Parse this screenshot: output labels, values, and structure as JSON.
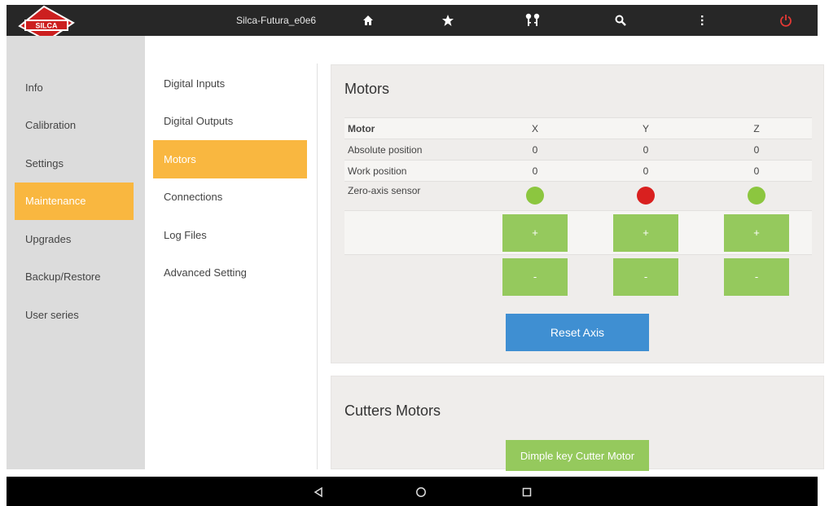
{
  "header": {
    "logo_text": "SILCA",
    "device_name": "Silca-Futura_e0e6",
    "icons": [
      "home-icon",
      "star-icon",
      "keys-icon",
      "search-icon",
      "more-vertical-icon",
      "power-icon"
    ]
  },
  "sidebar": {
    "items": [
      {
        "label": "Info"
      },
      {
        "label": "Calibration"
      },
      {
        "label": "Settings"
      },
      {
        "label": "Maintenance",
        "active": true
      },
      {
        "label": "Upgrades"
      },
      {
        "label": "Backup/Restore"
      },
      {
        "label": "User series"
      }
    ]
  },
  "subnav": {
    "items": [
      {
        "label": "Digital Inputs"
      },
      {
        "label": "Digital Outputs"
      },
      {
        "label": "Motors",
        "active": true
      },
      {
        "label": "Connections"
      },
      {
        "label": "Log Files"
      },
      {
        "label": "Advanced Setting"
      }
    ]
  },
  "motors": {
    "title": "Motors",
    "columns": [
      "Motor",
      "X",
      "Y",
      "Z"
    ],
    "rows": [
      {
        "label": "Absolute position",
        "values": [
          "0",
          "0",
          "0"
        ]
      },
      {
        "label": "Work position",
        "values": [
          "0",
          "0",
          "0"
        ]
      }
    ],
    "sensor": {
      "label": "Zero-axis sensor",
      "states": [
        "green",
        "red",
        "green"
      ]
    },
    "plus_label": "+",
    "minus_label": "-",
    "reset_label": "Reset Axis"
  },
  "cutters": {
    "title": "Cutters Motors",
    "button_label": "Dimple key Cutter Motor"
  },
  "colors": {
    "accent": "#f9b740",
    "green": "#95c95d",
    "blue": "#3f8fd2",
    "sensor_green": "#8cc63f",
    "sensor_red": "#d9201f",
    "power": "#e53935"
  },
  "android_nav": [
    "back-icon",
    "home-circle-icon",
    "recents-icon"
  ]
}
